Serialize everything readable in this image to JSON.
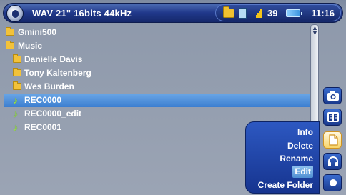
{
  "header": {
    "file_info": "WAV 21\" 16bits 44kHz",
    "volume": "39",
    "time": "11:16",
    "icons": [
      "app-logo-icon",
      "folder-status-icon",
      "document-status-icon",
      "speaker-icon",
      "battery-icon"
    ]
  },
  "file_list": {
    "items": [
      {
        "label": "Gmini500",
        "type": "folder",
        "depth": 0
      },
      {
        "label": "Music",
        "type": "folder",
        "depth": 0
      },
      {
        "label": "Danielle Davis",
        "type": "folder",
        "depth": 1
      },
      {
        "label": "Tony Kaltenberg",
        "type": "folder",
        "depth": 1
      },
      {
        "label": "Wes Burden",
        "type": "folder",
        "depth": 1
      },
      {
        "label": "REC0000",
        "type": "audio",
        "depth": 1,
        "selected": true
      },
      {
        "label": "REC0000_edit",
        "type": "audio",
        "depth": 1
      },
      {
        "label": "REC0001",
        "type": "audio",
        "depth": 1
      }
    ]
  },
  "side_dock": {
    "buttons": [
      "camera-icon",
      "browser-icon",
      "document-icon",
      "headphones-icon",
      "record-icon"
    ],
    "active": "document-icon"
  },
  "context_menu": {
    "items": [
      "Info",
      "Delete",
      "Rename",
      "Edit",
      "Create Folder"
    ],
    "highlighted": "Edit"
  },
  "colors": {
    "selection": "#4a8ad8",
    "header": "#20388a",
    "folder": "#f2c23a",
    "audio_note": "#9ae04c"
  }
}
